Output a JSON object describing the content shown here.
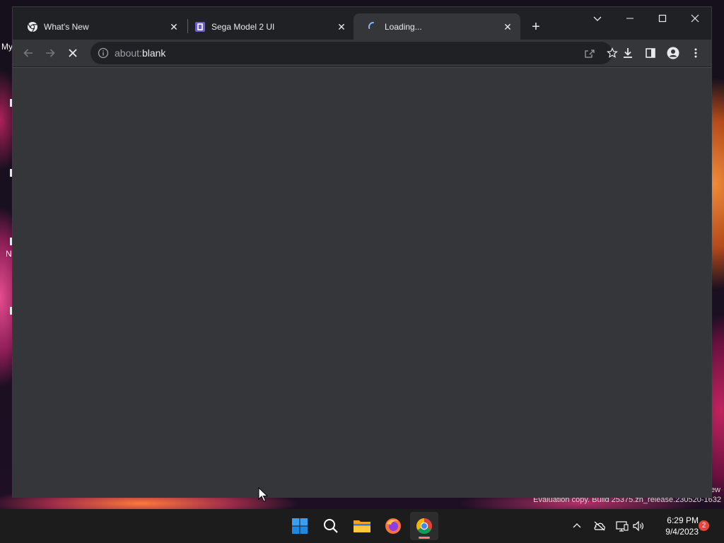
{
  "desktop": {
    "label_top": "My",
    "label_mid": "N",
    "watermark": "Evaluation copy. Build 25375.zn_release.230520-1632",
    "watermark_fragment": "ew"
  },
  "browser": {
    "tabs": [
      {
        "title": "What's New",
        "favicon": "chrome-icon",
        "active": false
      },
      {
        "title": "Sega Model 2 UI",
        "favicon": "sega-model2-icon",
        "active": false
      },
      {
        "title": "Loading...",
        "favicon": "loading-spinner-icon",
        "active": true
      }
    ],
    "tab_close_glyph": "✕",
    "new_tab_glyph": "+",
    "address": {
      "scheme": "about:",
      "host": "blank"
    },
    "page_background": "#35363a"
  },
  "taskbar": {
    "apps": [
      {
        "name": "Start",
        "icon": "windows-start-icon"
      },
      {
        "name": "Search",
        "icon": "search-icon"
      },
      {
        "name": "File Explorer",
        "icon": "folder-icon"
      },
      {
        "name": "Firefox",
        "icon": "firefox-icon"
      },
      {
        "name": "Google Chrome",
        "icon": "chrome-icon",
        "active": true
      }
    ],
    "time": "6:29 PM",
    "date": "9/4/2023",
    "notification_count": "2"
  }
}
